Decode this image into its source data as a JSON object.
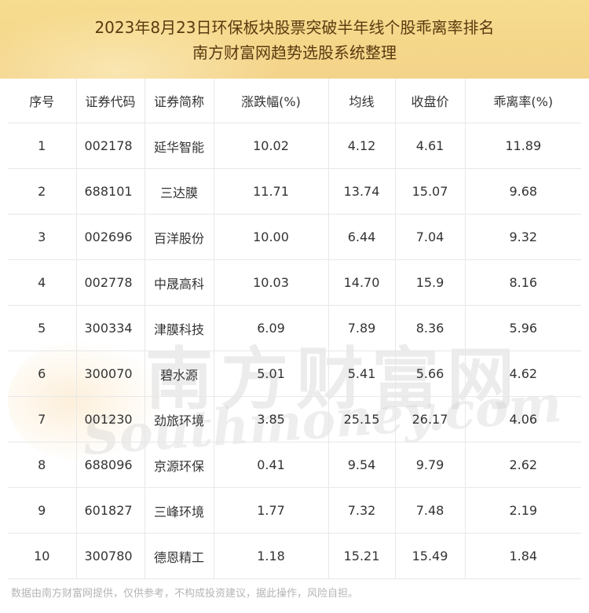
{
  "header": {
    "title_line1": "2023年8月23日环保板块股票突破半年线个股乖离率排名",
    "title_line2": "南方财富网趋势选股系统整理"
  },
  "table": {
    "columns": [
      "序号",
      "证券代码",
      "证券简称",
      "涨跌幅(%)",
      "均线",
      "收盘价",
      "乖离率(%)"
    ],
    "rows": [
      [
        "1",
        "002178",
        "延华智能",
        "10.02",
        "4.12",
        "4.61",
        "11.89"
      ],
      [
        "2",
        "688101",
        "三达膜",
        "11.71",
        "13.74",
        "15.07",
        "9.68"
      ],
      [
        "3",
        "002696",
        "百洋股份",
        "10.00",
        "6.44",
        "7.04",
        "9.32"
      ],
      [
        "4",
        "002778",
        "中晟高科",
        "10.03",
        "14.70",
        "15.9",
        "8.16"
      ],
      [
        "5",
        "300334",
        "津膜科技",
        "6.09",
        "7.89",
        "8.36",
        "5.96"
      ],
      [
        "6",
        "300070",
        "碧水源",
        "5.01",
        "5.41",
        "5.66",
        "4.62"
      ],
      [
        "7",
        "001230",
        "劲旅环境",
        "3.85",
        "25.15",
        "26.17",
        "4.06"
      ],
      [
        "8",
        "688096",
        "京源环保",
        "0.41",
        "9.54",
        "9.79",
        "2.62"
      ],
      [
        "9",
        "601827",
        "三峰环境",
        "1.77",
        "7.32",
        "7.48",
        "2.19"
      ],
      [
        "10",
        "300780",
        "德恩精工",
        "1.18",
        "15.21",
        "15.49",
        "1.84"
      ]
    ]
  },
  "watermark": {
    "cn": "南方财富网",
    "en": "Southmoney.com"
  },
  "footer": "数据由南方财富网提供，仅供参考，不构成投资建议，据此操作，风险自担。"
}
